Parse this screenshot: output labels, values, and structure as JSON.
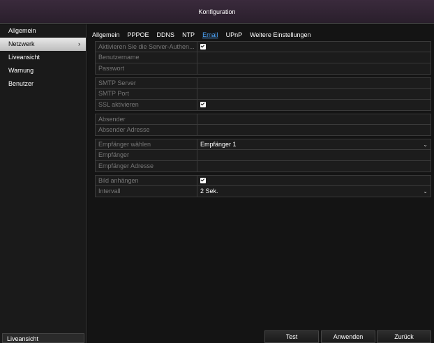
{
  "window": {
    "title": "Konfiguration"
  },
  "sidebar": {
    "items": [
      {
        "label": "Allgemein"
      },
      {
        "label": "Netzwerk",
        "chevron": "›"
      },
      {
        "label": "Liveansicht"
      },
      {
        "label": "Warnung"
      },
      {
        "label": "Benutzer"
      }
    ],
    "bottom_button": "Liveansicht"
  },
  "tabs": [
    {
      "label": "Allgemein"
    },
    {
      "label": "PPPOE"
    },
    {
      "label": "DDNS"
    },
    {
      "label": "NTP"
    },
    {
      "label": "Email"
    },
    {
      "label": "UPnP"
    },
    {
      "label": "Weitere Einstellungen"
    }
  ],
  "form": {
    "auth_label": "Aktivieren Sie die Server-Authen...",
    "username_label": "Benutzername",
    "password_label": "Passwort",
    "smtp_server_label": "SMTP Server",
    "smtp_port_label": "SMTP Port",
    "ssl_label": "SSL aktivieren",
    "sender_label": "Absender",
    "sender_address_label": "Absender Adresse",
    "recipient_select_label": "Empfänger wählen",
    "recipient_select_value": "Empfänger 1",
    "recipient_label": "Empfänger",
    "recipient_address_label": "Empfänger Adresse",
    "attach_image_label": "Bild anhängen",
    "interval_label": "Intervall",
    "interval_value": "2 Sek.",
    "dropdown_arrow": "⌄"
  },
  "buttons": {
    "test": "Test",
    "apply": "Anwenden",
    "back": "Zurück"
  },
  "colors": {
    "active_tab": "#4fa8ff",
    "title_bar": "#3a2a3c"
  }
}
